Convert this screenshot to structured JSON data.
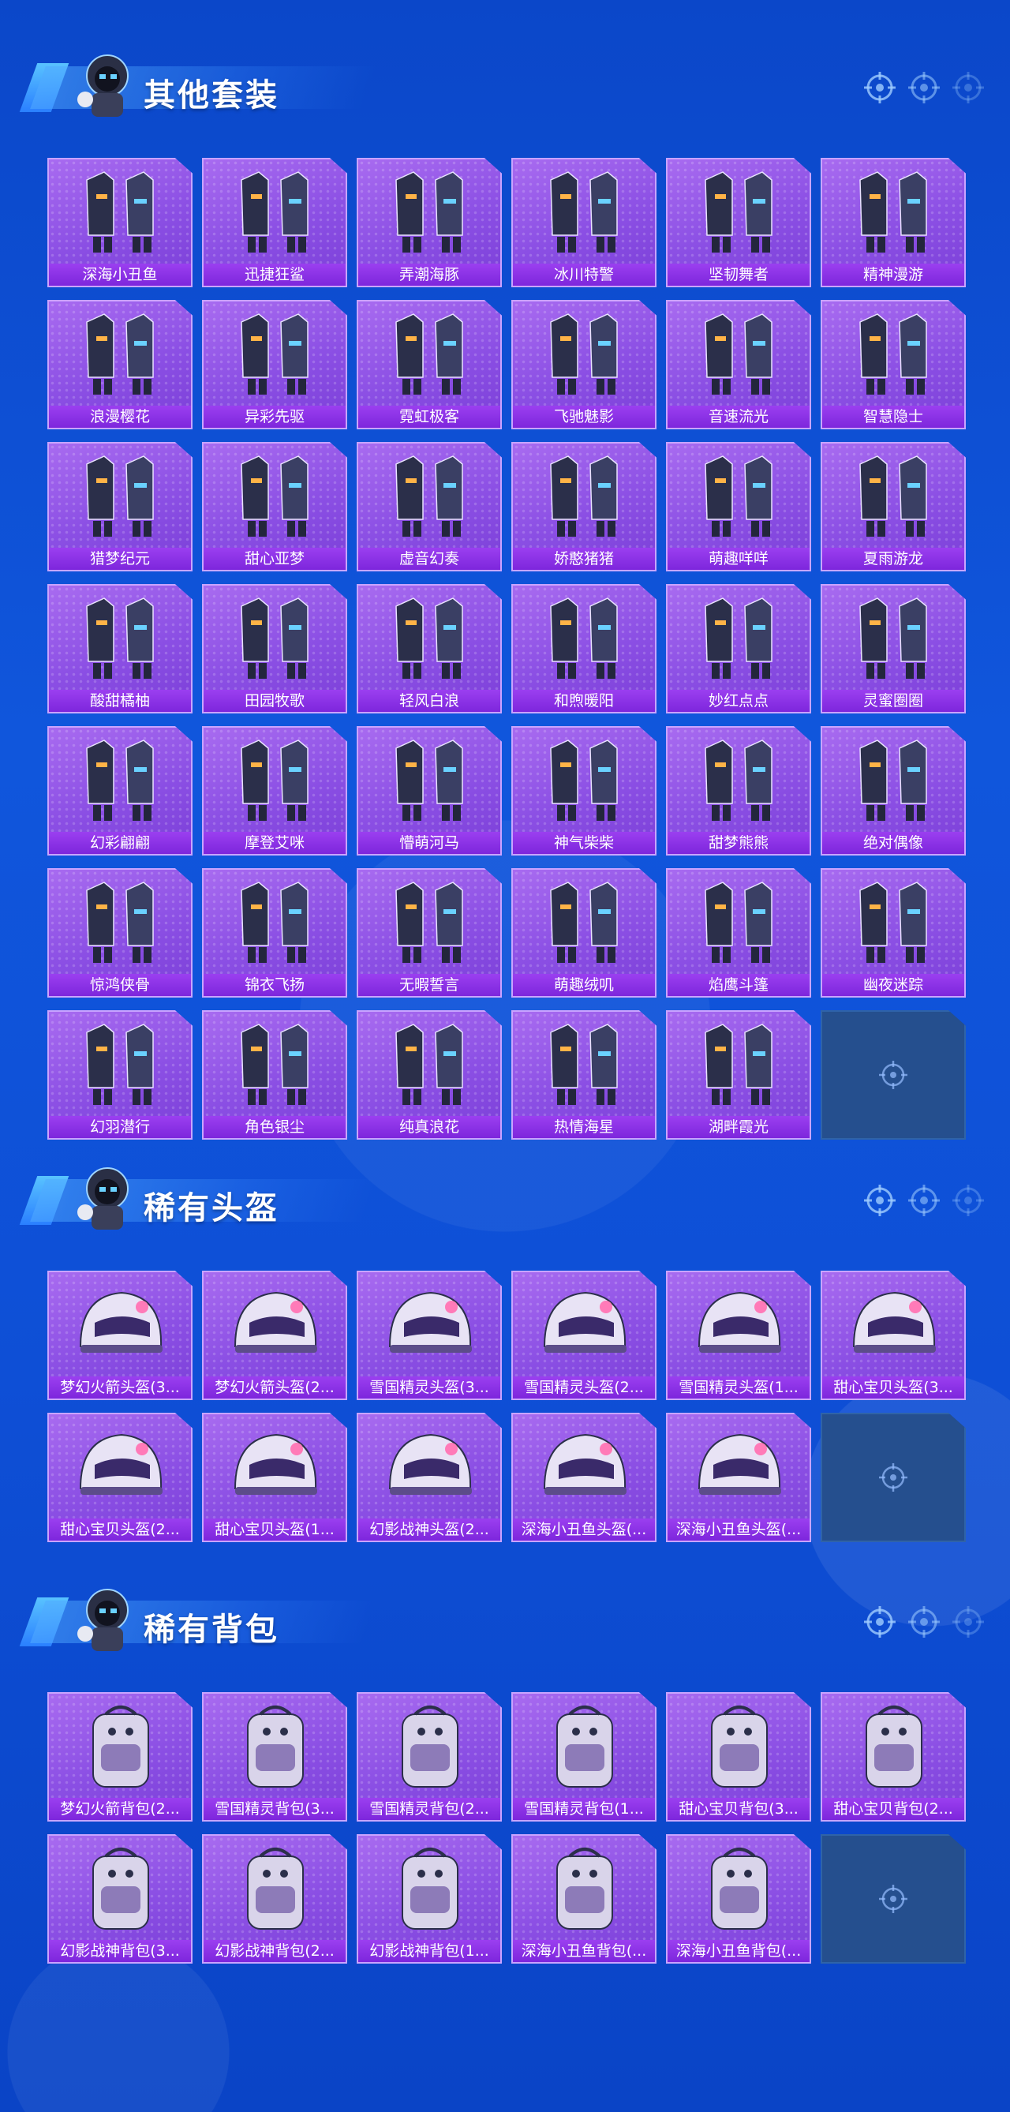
{
  "colors": {
    "page_background": "#0e4fd6",
    "card_purple": "#8b4fe4",
    "card_border": "#c9a4ff",
    "label_purple": "#7d26dc",
    "empty_slot": "#254f8e",
    "title_text": "#ffffff"
  },
  "sections": [
    {
      "title": "其他套装",
      "items": [
        {
          "name": "深海小丑鱼",
          "icon": "outfit-icon"
        },
        {
          "name": "迅捷狂鲨",
          "icon": "outfit-icon"
        },
        {
          "name": "弄潮海豚",
          "icon": "outfit-icon"
        },
        {
          "name": "冰川特警",
          "icon": "outfit-icon"
        },
        {
          "name": "坚韧舞者",
          "icon": "outfit-icon"
        },
        {
          "name": "精神漫游",
          "icon": "outfit-icon"
        },
        {
          "name": "浪漫樱花",
          "icon": "outfit-icon"
        },
        {
          "name": "异彩先驱",
          "icon": "outfit-icon"
        },
        {
          "name": "霓虹极客",
          "icon": "outfit-icon"
        },
        {
          "name": "飞驰魅影",
          "icon": "outfit-icon"
        },
        {
          "name": "音速流光",
          "icon": "outfit-icon"
        },
        {
          "name": "智慧隐士",
          "icon": "outfit-icon"
        },
        {
          "name": "猎梦纪元",
          "icon": "outfit-icon"
        },
        {
          "name": "甜心亚梦",
          "icon": "outfit-icon"
        },
        {
          "name": "虚音幻奏",
          "icon": "outfit-icon"
        },
        {
          "name": "娇憨猪猪",
          "icon": "outfit-icon"
        },
        {
          "name": "萌趣咩咩",
          "icon": "outfit-icon"
        },
        {
          "name": "夏雨游龙",
          "icon": "outfit-icon"
        },
        {
          "name": "酸甜橘柚",
          "icon": "outfit-icon"
        },
        {
          "name": "田园牧歌",
          "icon": "outfit-icon"
        },
        {
          "name": "轻风白浪",
          "icon": "outfit-icon"
        },
        {
          "name": "和煦暖阳",
          "icon": "outfit-icon"
        },
        {
          "name": "妙红点点",
          "icon": "outfit-icon"
        },
        {
          "name": "灵蜜圈圈",
          "icon": "outfit-icon"
        },
        {
          "name": "幻彩翩翩",
          "icon": "outfit-icon"
        },
        {
          "name": "摩登艾咪",
          "icon": "outfit-icon"
        },
        {
          "name": "懵萌河马",
          "icon": "outfit-icon"
        },
        {
          "name": "神气柴柴",
          "icon": "outfit-icon"
        },
        {
          "name": "甜梦熊熊",
          "icon": "outfit-icon"
        },
        {
          "name": "绝对偶像",
          "icon": "outfit-icon"
        },
        {
          "name": "惊鸿侠骨",
          "icon": "outfit-icon"
        },
        {
          "name": "锦衣飞扬",
          "icon": "outfit-icon"
        },
        {
          "name": "无暇誓言",
          "icon": "outfit-icon"
        },
        {
          "name": "萌趣绒叽",
          "icon": "outfit-icon"
        },
        {
          "name": "焰鹰斗篷",
          "icon": "outfit-icon"
        },
        {
          "name": "幽夜迷踪",
          "icon": "outfit-icon"
        },
        {
          "name": "幻羽潜行",
          "icon": "outfit-icon"
        },
        {
          "name": "角色银尘",
          "icon": "outfit-icon"
        },
        {
          "name": "纯真浪花",
          "icon": "outfit-icon"
        },
        {
          "name": "热情海星",
          "icon": "outfit-icon"
        },
        {
          "name": "湖畔霞光",
          "icon": "outfit-icon"
        }
      ]
    },
    {
      "title": "稀有头盔",
      "items": [
        {
          "name": "梦幻火箭头盔(3...",
          "icon": "helmet-icon"
        },
        {
          "name": "梦幻火箭头盔(2...",
          "icon": "helmet-icon"
        },
        {
          "name": "雪国精灵头盔(3...",
          "icon": "helmet-icon"
        },
        {
          "name": "雪国精灵头盔(2...",
          "icon": "helmet-icon"
        },
        {
          "name": "雪国精灵头盔(1...",
          "icon": "helmet-icon"
        },
        {
          "name": "甜心宝贝头盔(3...",
          "icon": "helmet-icon"
        },
        {
          "name": "甜心宝贝头盔(2...",
          "icon": "helmet-icon"
        },
        {
          "name": "甜心宝贝头盔(1...",
          "icon": "helmet-icon"
        },
        {
          "name": "幻影战神头盔(2...",
          "icon": "helmet-icon"
        },
        {
          "name": "深海小丑鱼头盔(...",
          "icon": "helmet-icon"
        },
        {
          "name": "深海小丑鱼头盔(...",
          "icon": "helmet-icon"
        }
      ]
    },
    {
      "title": "稀有背包",
      "items": [
        {
          "name": "梦幻火箭背包(2...",
          "icon": "backpack-icon"
        },
        {
          "name": "雪国精灵背包(3...",
          "icon": "backpack-icon"
        },
        {
          "name": "雪国精灵背包(2...",
          "icon": "backpack-icon"
        },
        {
          "name": "雪国精灵背包(1...",
          "icon": "backpack-icon"
        },
        {
          "name": "甜心宝贝背包(3...",
          "icon": "backpack-icon"
        },
        {
          "name": "甜心宝贝背包(2...",
          "icon": "backpack-icon"
        },
        {
          "name": "幻影战神背包(3...",
          "icon": "backpack-icon"
        },
        {
          "name": "幻影战神背包(2...",
          "icon": "backpack-icon"
        },
        {
          "name": "幻影战神背包(1...",
          "icon": "backpack-icon"
        },
        {
          "name": "深海小丑鱼背包(...",
          "icon": "backpack-icon"
        },
        {
          "name": "深海小丑鱼背包(...",
          "icon": "backpack-icon"
        }
      ]
    }
  ]
}
